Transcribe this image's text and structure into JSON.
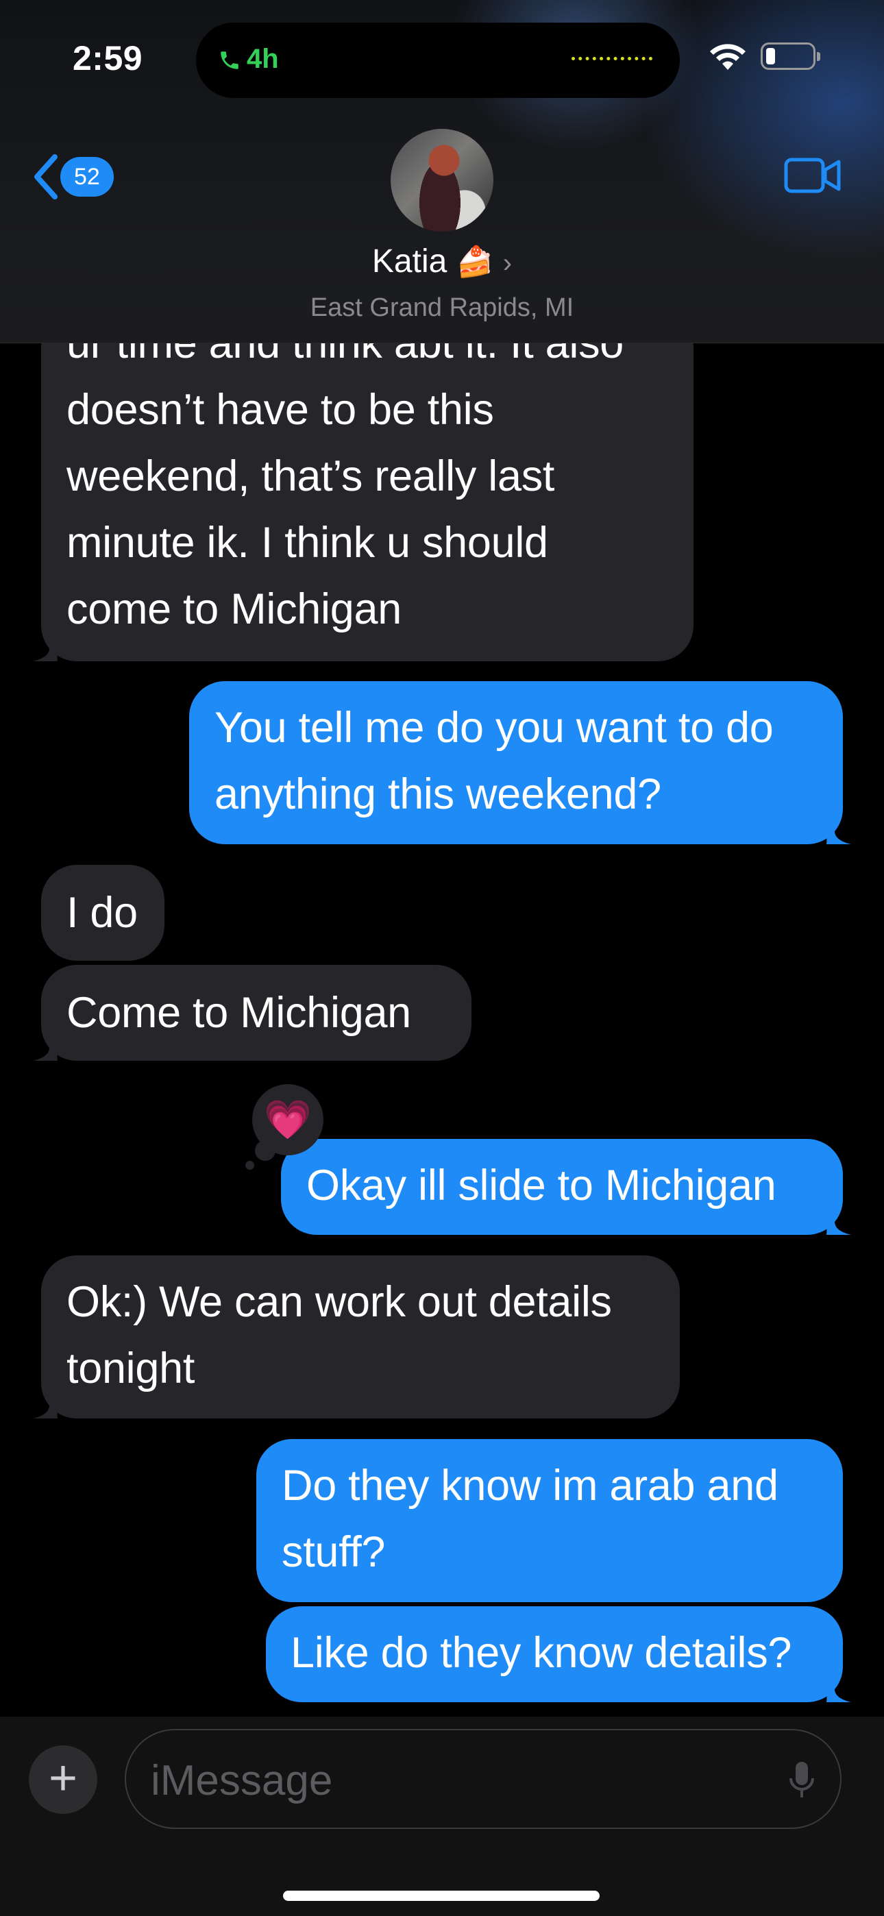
{
  "status_bar": {
    "time": "2:59",
    "call_duration": "4h",
    "wifi_icon": "wifi-icon",
    "battery_icon": "battery-icon"
  },
  "header": {
    "back_icon": "chevron-left-icon",
    "unread_count": "52",
    "contact_name": "Katia",
    "contact_emoji": "🍰",
    "disclosure": "›",
    "location": "East Grand Rapids, MI",
    "video_icon": "video-camera-icon"
  },
  "messages": [
    {
      "direction": "incoming",
      "lines": [
        "ur time and think abt it. It also",
        "doesn’t have to be this",
        "weekend, that’s really last",
        "minute ik. I think u should",
        "come to Michigan"
      ]
    },
    {
      "direction": "outgoing",
      "lines": [
        "You tell me do you want to do",
        "anything this weekend?"
      ]
    },
    {
      "direction": "incoming",
      "lines": [
        "I do"
      ]
    },
    {
      "direction": "incoming",
      "lines": [
        "Come to Michigan"
      ]
    },
    {
      "direction": "outgoing",
      "lines": [
        "Okay ill slide to Michigan"
      ],
      "reaction": "💗"
    },
    {
      "direction": "incoming",
      "lines": [
        "Ok:) We can work out details",
        "tonight"
      ]
    },
    {
      "direction": "outgoing",
      "lines": [
        "Do they know im arab and",
        "stuff?"
      ]
    },
    {
      "direction": "outgoing",
      "lines": [
        "Like do they know details?"
      ]
    }
  ],
  "composer": {
    "plus_label": "+",
    "placeholder": "iMessage",
    "mic_icon": "microphone-icon"
  },
  "colors": {
    "outgoing_bubble": "#1f8bf7",
    "incoming_bubble": "#26252a",
    "accent": "#1f8bf7",
    "call_green": "#34d058"
  }
}
